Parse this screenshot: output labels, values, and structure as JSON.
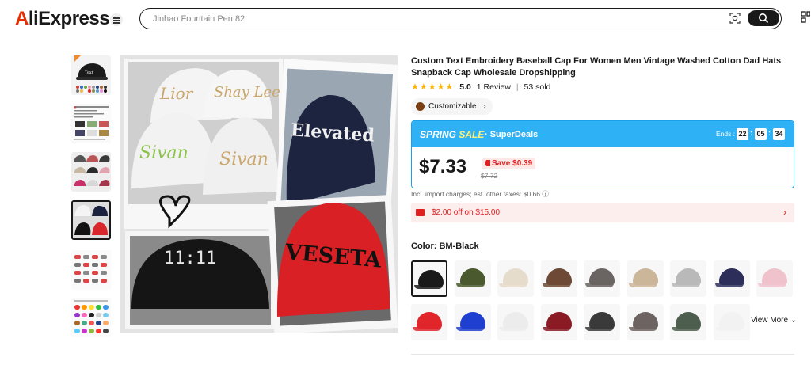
{
  "header": {
    "logo": "AliExpress",
    "search_placeholder": "Jinhao Fountain Pen 82"
  },
  "gallery": {
    "thumbnails": [
      "thumb-1",
      "thumb-2",
      "thumb-3",
      "thumb-4",
      "thumb-5",
      "thumb-6"
    ],
    "selected_index": 3
  },
  "product": {
    "title": "Custom Text Embroidery Baseball Cap For Women Men Vintage Washed Cotton Dad Hats Snapback Cap Wholesale Dropshipping",
    "rating": "5.0",
    "reviews": "1 Review",
    "sold": "53 sold",
    "customizable": "Customizable",
    "deal": {
      "spring": "SPRING",
      "sale": "SALE",
      "superdeals": "· SuperDeals",
      "ends_label": "Ends :",
      "hh": "22",
      "mm": "05",
      "ss": "34",
      "price": "$7.33",
      "save": "Save $0.39",
      "original_price": "$7.72"
    },
    "taxes": "Incl. import charges; est. other taxes: $0.66 ⓘ",
    "coupon": "$2.00 off on $15.00",
    "color_label": "Color: BM-Black",
    "view_more": "View More",
    "colors": [
      {
        "name": "black",
        "hex": "#1a1a1a"
      },
      {
        "name": "olive",
        "hex": "#4a5a2e"
      },
      {
        "name": "beige",
        "hex": "#e6dccb"
      },
      {
        "name": "brown",
        "hex": "#6e4a36"
      },
      {
        "name": "gray",
        "hex": "#6a6462"
      },
      {
        "name": "khaki",
        "hex": "#cbb69a"
      },
      {
        "name": "light-gray",
        "hex": "#b9b9b9"
      },
      {
        "name": "navy",
        "hex": "#2d2f5a"
      },
      {
        "name": "pink",
        "hex": "#f0c3cc"
      },
      {
        "name": "red",
        "hex": "#e0262b"
      },
      {
        "name": "royal-blue",
        "hex": "#1f3fd0"
      },
      {
        "name": "white",
        "hex": "#ececec"
      },
      {
        "name": "burgundy",
        "hex": "#8a1a24"
      },
      {
        "name": "charcoal",
        "hex": "#3a3a3a"
      },
      {
        "name": "taupe",
        "hex": "#6d6360"
      },
      {
        "name": "green",
        "hex": "#4e5e4e"
      },
      {
        "name": "off-white",
        "hex": "#f2f2f2"
      }
    ]
  }
}
